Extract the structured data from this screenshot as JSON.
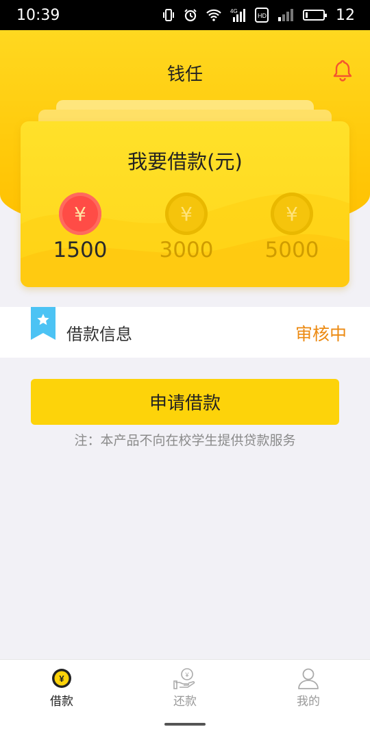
{
  "status_bar": {
    "time": "10:39",
    "battery": "12",
    "battery_level": 0.12,
    "network_label": "4G"
  },
  "header": {
    "title": "钱任"
  },
  "loan_card": {
    "title": "我要借款(元)",
    "currency_symbol": "¥",
    "options": [
      {
        "amount": "1500",
        "selected": true
      },
      {
        "amount": "3000",
        "selected": false
      },
      {
        "amount": "5000",
        "selected": false
      }
    ]
  },
  "info": {
    "label": "借款信息",
    "status": "审核中"
  },
  "actions": {
    "apply_label": "申请借款",
    "notice": "注：本产品不向在校学生提供贷款服务"
  },
  "bottom_nav": {
    "items": [
      {
        "label": "借款",
        "icon": "yuan-coin-icon",
        "active": true
      },
      {
        "label": "还款",
        "icon": "repay-hand-icon",
        "active": false
      },
      {
        "label": "我的",
        "icon": "user-icon",
        "active": false
      }
    ]
  },
  "colors": {
    "brand_yellow": "#ffd61a",
    "selected_coin": "#ff4c46",
    "status_orange": "#ec8a12",
    "ribbon_blue": "#4cc3f4"
  }
}
